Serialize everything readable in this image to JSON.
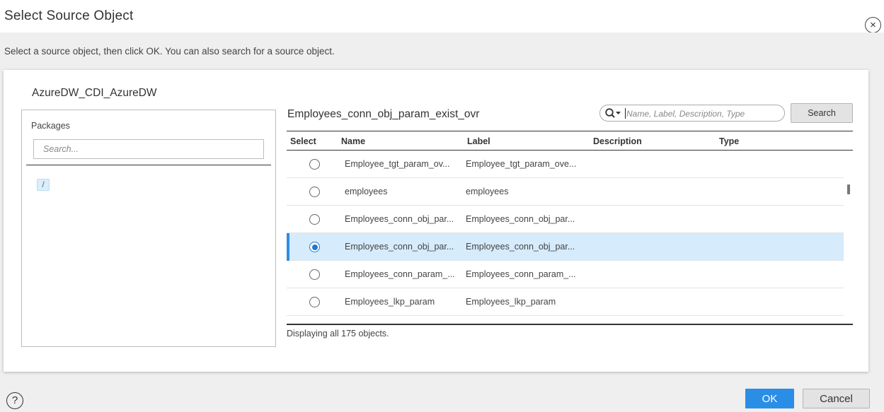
{
  "dialog": {
    "title": "Select Source Object",
    "close_glyph": "×",
    "instructions": "Select a source object, then click OK. You can also search for a source object.",
    "help_glyph": "?"
  },
  "connection": {
    "name": "AzureDW_CDI_AzureDW"
  },
  "packages": {
    "label": "Packages",
    "search_placeholder": "Search...",
    "root_folder": "/"
  },
  "objects": {
    "title": "Employees_conn_obj_param_exist_ovr",
    "search_placeholder": "Name, Label, Description, Type",
    "search_button": "Search",
    "columns": {
      "select": "Select",
      "name": "Name",
      "label": "Label",
      "description": "Description",
      "type": "Type"
    },
    "rows": [
      {
        "name": "Employee_tgt_param_ov...",
        "label": "Employee_tgt_param_ove...",
        "selected": false
      },
      {
        "name": "employees",
        "label": "employees",
        "selected": false
      },
      {
        "name": "Employees_conn_obj_par...",
        "label": "Employees_conn_obj_par...",
        "selected": false
      },
      {
        "name": "Employees_conn_obj_par...",
        "label": "Employees_conn_obj_par...",
        "selected": true
      },
      {
        "name": "Employees_conn_param_...",
        "label": "Employees_conn_param_...",
        "selected": false
      },
      {
        "name": "Employees_lkp_param",
        "label": "Employees_lkp_param",
        "selected": false
      }
    ],
    "display_count": "Displaying all 175 objects."
  },
  "footer": {
    "ok_label": "OK",
    "cancel_label": "Cancel"
  },
  "colors": {
    "accent": "#2b8ee6",
    "selected_row": "#d6ebfb",
    "body_bg": "#efefef"
  },
  "icons": {
    "close": "close-icon",
    "help": "help-icon",
    "search": "search-icon",
    "folder": "folder-icon"
  }
}
